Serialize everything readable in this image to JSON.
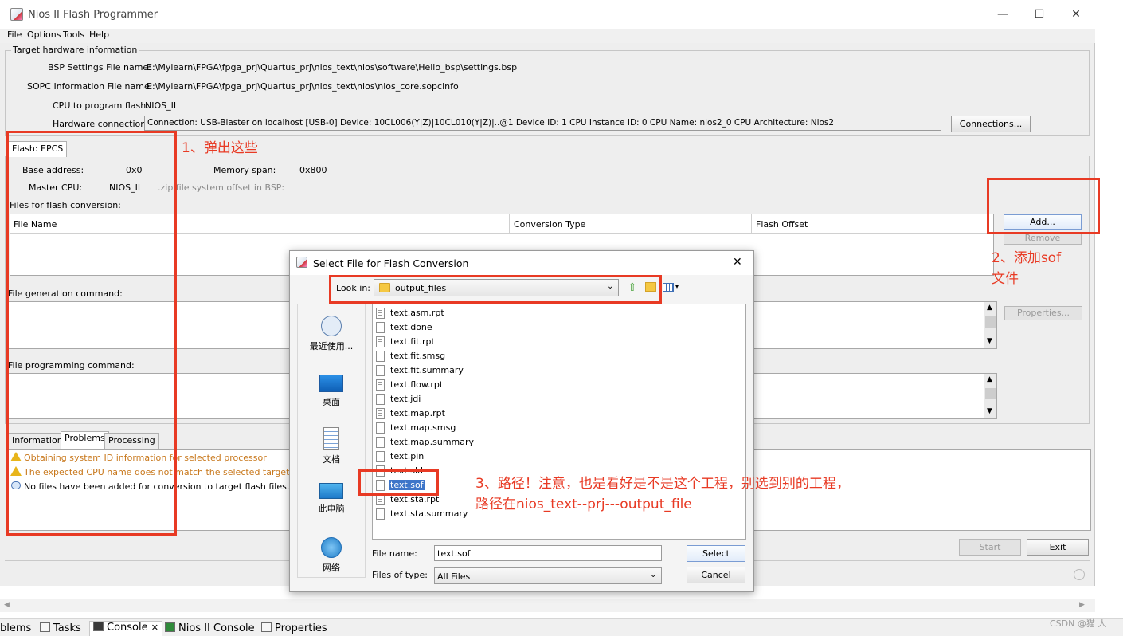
{
  "window": {
    "title": "Nios II Flash Programmer",
    "minimize": "—",
    "maximize": "☐",
    "close": "✕"
  },
  "menu": [
    "File",
    "Options",
    "Tools",
    "Help"
  ],
  "hardware": {
    "group_title": "Target hardware information",
    "bsp_label": "BSP Settings File name:",
    "bsp_value": "E:\\Mylearn\\FPGA\\fpga_prj\\Quartus_prj\\nios_text\\nios\\software\\Hello_bsp\\settings.bsp",
    "sopc_label": "SOPC Information File name:",
    "sopc_value": "E:\\Mylearn\\FPGA\\fpga_prj\\Quartus_prj\\nios_text\\nios\\nios_core.sopcinfo",
    "cpu_label": "CPU to program flash:",
    "cpu_value": "NIOS_II",
    "conn_label": "Hardware connection:",
    "conn_value": "Connection: USB-Blaster on localhost [USB-0]    Device: 10CL006(Y|Z)|10CL010(Y|Z)|..@1    Device ID: 1    CPU Instance ID: 0    CPU Name: nios2_0    CPU Architecture: Nios2",
    "connections_button": "Connections..."
  },
  "flash": {
    "tab": "Flash: EPCS",
    "base_label": "Base address:",
    "base_value": "0x0",
    "span_label": "Memory span:",
    "span_value": "0x800",
    "master_label": "Master CPU:",
    "master_value": "NIOS_II",
    "zip_label": ".zip file system offset in BSP:",
    "files_label": "Files for flash conversion:",
    "columns": [
      "File Name",
      "Conversion Type",
      "Flash Offset"
    ],
    "add_button": "Add...",
    "remove_button": "Remove",
    "gen_label": "File generation command:",
    "prog_label": "File programming command:",
    "properties_button": "Properties..."
  },
  "messages": {
    "tabs": [
      "Information",
      "Problems",
      "Processing"
    ],
    "items": [
      {
        "kind": "warning",
        "text": "Obtaining system ID information for selected processor"
      },
      {
        "kind": "warning",
        "text": "The expected CPU name does not match the selected target CPU nam"
      },
      {
        "kind": "info",
        "text": "No files have been added for conversion to target flash files."
      }
    ]
  },
  "footer": {
    "start_button": "Start",
    "exit_button": "Exit"
  },
  "dialog": {
    "title": "Select File for Flash Conversion",
    "close": "✕",
    "lookin_label": "Look in:",
    "lookin_value": "output_files",
    "places": [
      "最近使用...",
      "桌面",
      "文档",
      "此电脑",
      "网络"
    ],
    "files": [
      "text.asm.rpt",
      "text.done",
      "text.fit.rpt",
      "text.fit.smsg",
      "text.fit.summary",
      "text.flow.rpt",
      "text.jdi",
      "text.map.rpt",
      "text.map.smsg",
      "text.map.summary",
      "text.pin",
      "text.sld",
      "text.sof",
      "text.sta.rpt",
      "text.sta.summary"
    ],
    "filename_label": "File name:",
    "filename_value": "text.sof",
    "filetype_label": "Files of type:",
    "filetype_value": "All Files",
    "select_button": "Select",
    "cancel_button": "Cancel"
  },
  "annotations": {
    "note1": "1、弹出这些",
    "note2_line1": "2、添加sof",
    "note2_line2": "文件",
    "note3_line1": "3、路径！注意，也是看好是不是这个工程，别选到别的工程，",
    "note3_line2": "路径在nios_text--prj---output_file"
  },
  "taskbar": {
    "tabs": [
      "blems",
      "Tasks",
      "Console",
      "Nios II Console",
      "Properties"
    ],
    "console_close": "✕",
    "watermark": "CSDN @猫 人"
  },
  "colors": {
    "annotation_red": "#e83a24",
    "selection_blue": "#3d75c9",
    "warning_text": "#c8781c"
  }
}
